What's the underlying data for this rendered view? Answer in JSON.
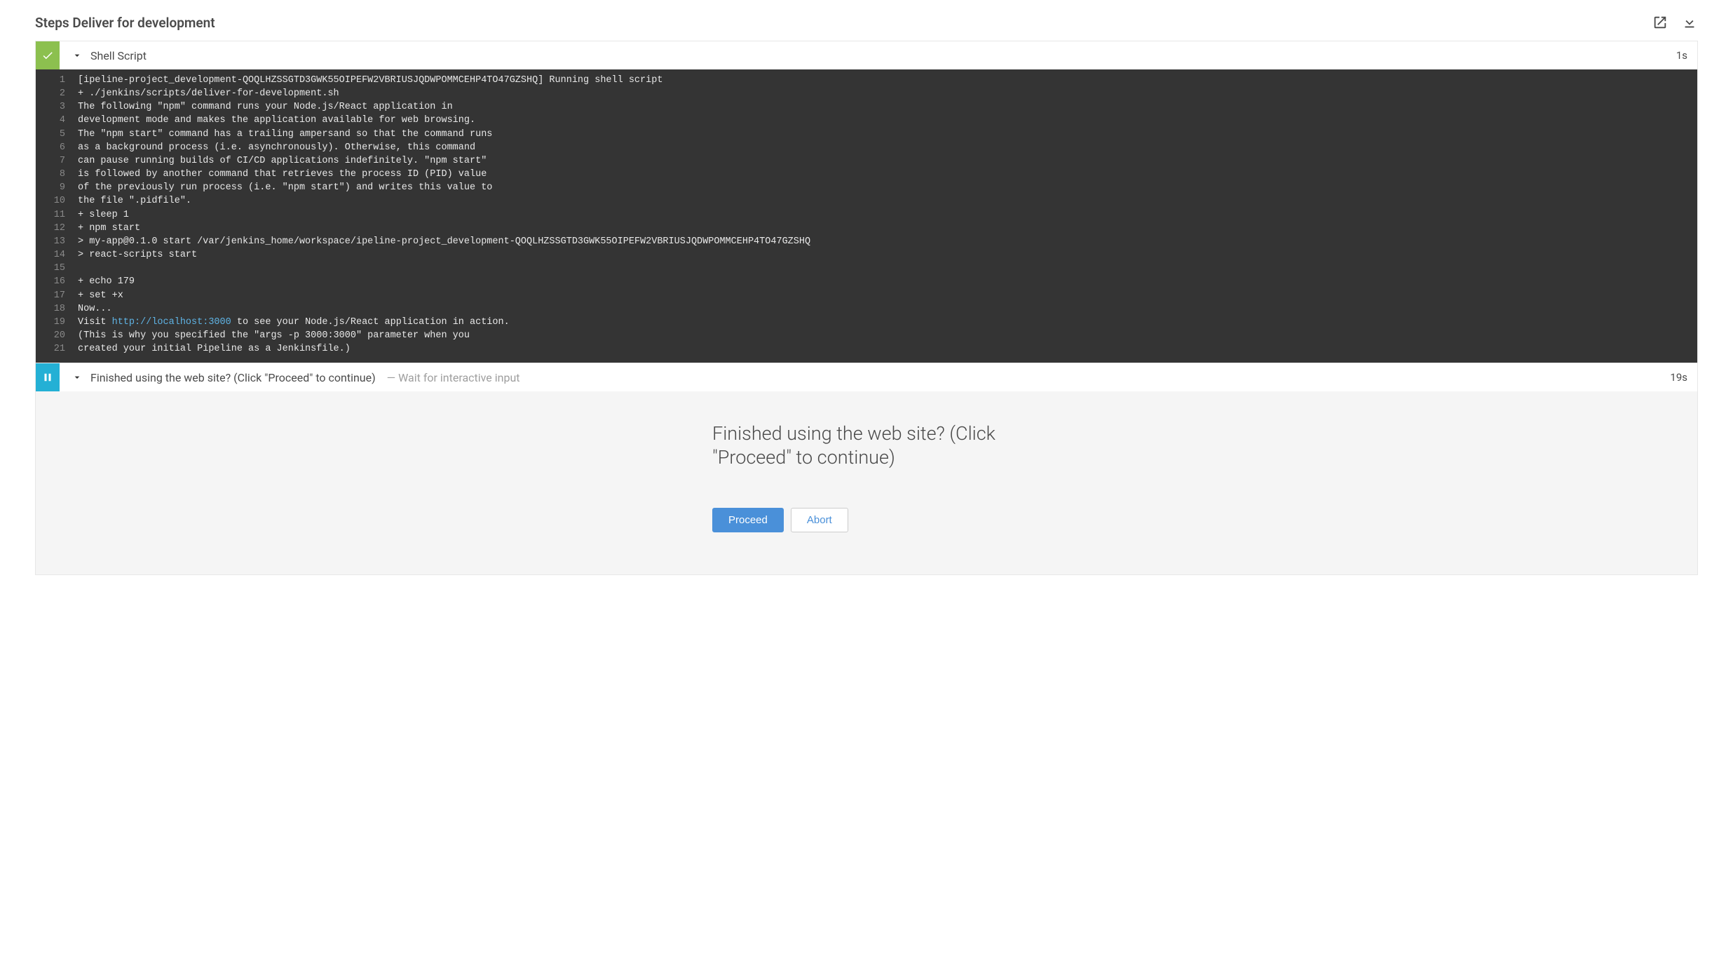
{
  "header": {
    "title_prefix": "Steps",
    "title_stage": "Deliver for development"
  },
  "steps": [
    {
      "status": "success",
      "title": "Shell Script",
      "duration": "1s",
      "log": [
        "[ipeline-project_development-QOQLHZSSGTD3GWK55OIPEFW2VBRIUSJQDWPOMMCEHP4TO47GZSHQ] Running shell script",
        "+ ./jenkins/scripts/deliver-for-development.sh",
        "The following \"npm\" command runs your Node.js/React application in",
        "development mode and makes the application available for web browsing.",
        "The \"npm start\" command has a trailing ampersand so that the command runs",
        "as a background process (i.e. asynchronously). Otherwise, this command",
        "can pause running builds of CI/CD applications indefinitely. \"npm start\"",
        "is followed by another command that retrieves the process ID (PID) value",
        "of the previously run process (i.e. \"npm start\") and writes this value to",
        "the file \".pidfile\".",
        "+ sleep 1",
        "+ npm start",
        "> my-app@0.1.0 start /var/jenkins_home/workspace/ipeline-project_development-QOQLHZSSGTD3GWK55OIPEFW2VBRIUSJQDWPOMMCEHP4TO47GZSHQ",
        "> react-scripts start",
        "",
        "+ echo 179",
        "+ set +x",
        "Now...",
        "Visit http://localhost:3000 to see your Node.js/React application in action.",
        "(This is why you specified the \"args -p 3000:3000\" parameter when you",
        "created your initial Pipeline as a Jenkinsfile.)"
      ],
      "link_line_index": 18,
      "link_url": "http://localhost:3000"
    },
    {
      "status": "paused",
      "title": "Finished using the web site? (Click \"Proceed\" to continue)",
      "subtitle_dash": "—",
      "subtitle": "Wait for interactive input",
      "duration": "19s",
      "prompt": {
        "message": "Finished using the web site? (Click \"Proceed\" to continue)",
        "proceed_label": "Proceed",
        "abort_label": "Abort"
      }
    }
  ]
}
